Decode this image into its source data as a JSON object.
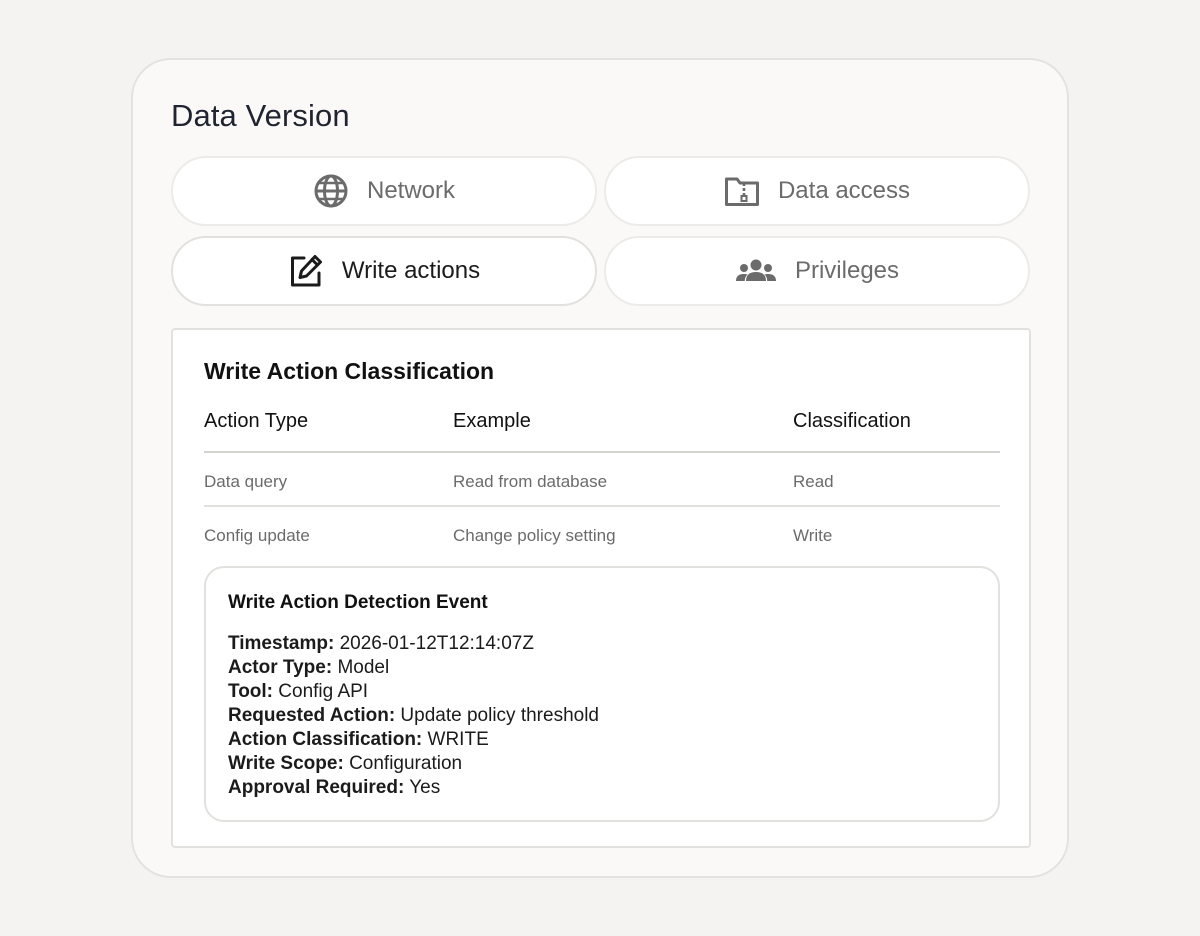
{
  "page": {
    "title": "Data Version"
  },
  "tabs": [
    {
      "label": "Network",
      "icon": "globe-icon",
      "active": false
    },
    {
      "label": "Data access",
      "icon": "folder-zip-icon",
      "active": false
    },
    {
      "label": "Write actions",
      "icon": "edit-icon",
      "active": true
    },
    {
      "label": "Privileges",
      "icon": "users-icon",
      "active": false
    }
  ],
  "panel": {
    "title": "Write Action Classification",
    "columns": [
      "Action Type",
      "Example",
      "Classification"
    ],
    "rows": [
      [
        "Data query",
        "Read from database",
        "Read"
      ],
      [
        "Config update",
        "Change policy setting",
        "Write"
      ]
    ]
  },
  "event": {
    "title": "Write Action Detection Event",
    "fields": [
      {
        "label": "Timestamp:",
        "value": "2026-01-12T12:14:07Z"
      },
      {
        "label": "Actor Type:",
        "value": "Model"
      },
      {
        "label": "Tool:",
        "value": "Config API"
      },
      {
        "label": "Requested Action:",
        "value": "Update policy threshold"
      },
      {
        "label": "Action Classification:",
        "value": "WRITE"
      },
      {
        "label": "Write Scope:",
        "value": "Configuration"
      },
      {
        "label": "Approval Required:",
        "value": "Yes"
      }
    ]
  },
  "colors": {
    "background": "#f4f3f1",
    "card": "#faf9f7",
    "text_primary": "#1f2430",
    "text_muted": "#6b6b6b"
  }
}
